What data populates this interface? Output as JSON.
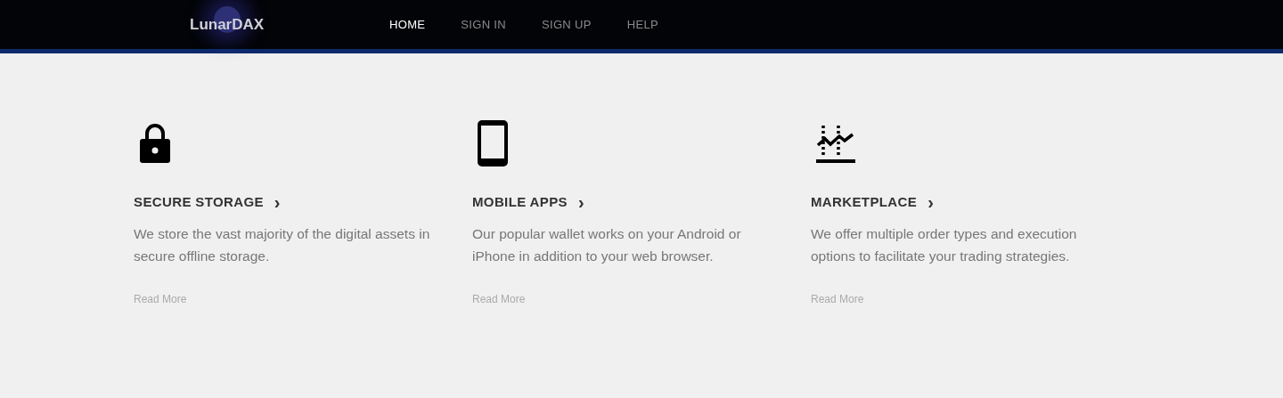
{
  "header": {
    "logo": "LunarDAX",
    "nav": [
      {
        "label": "HOME",
        "selected": true
      },
      {
        "label": "SIGN IN",
        "selected": false
      },
      {
        "label": "SIGN UP",
        "selected": false
      },
      {
        "label": "HELP",
        "selected": false
      }
    ]
  },
  "features": [
    {
      "kind": "lock",
      "title": "SECURE STORAGE",
      "arrow": "›",
      "description": "We store the vast majority of the digital assets in secure offline storage.",
      "link": "Read More"
    },
    {
      "kind": "phone",
      "title": "MOBILE APPS",
      "arrow": "›",
      "description": "Our popular wallet works on your Android or iPhone in addition to your web browser.",
      "link": "Read More"
    },
    {
      "kind": "chart",
      "title": "MARKETPLACE",
      "arrow": "›",
      "description": "We offer multiple order types and execution options to facilitate your trading strategies.",
      "link": "Read More"
    }
  ]
}
